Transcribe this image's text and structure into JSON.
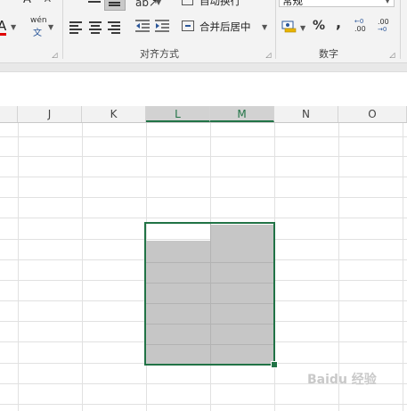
{
  "ribbon": {
    "font_group": {
      "font_color_glyph": "A",
      "phonetic_top": "wén",
      "phonetic_bottom": "文",
      "font_size_large_glyph": "A",
      "font_size_small_glyph": "A"
    },
    "alignment_group": {
      "label": "对齐方式",
      "wrap_text_label": "自动换行",
      "merge_center_label": "合并后居中"
    },
    "number_group": {
      "label": "数字",
      "format_value": "常规",
      "percent_glyph": "%",
      "comma_glyph": ",",
      "increase_decimal_top": "←0",
      "increase_decimal_bottom": ".00",
      "decrease_decimal_top": ".00",
      "decrease_decimal_bottom": "→0"
    }
  },
  "columns": [
    "J",
    "K",
    "L",
    "M",
    "N",
    "O"
  ],
  "selected_columns": [
    "L",
    "M"
  ],
  "watermark_text": "Baidu 经验",
  "colors": {
    "accent": "#217346",
    "selection_fill": "#c6c6c6",
    "font_color_red": "#e00000"
  }
}
